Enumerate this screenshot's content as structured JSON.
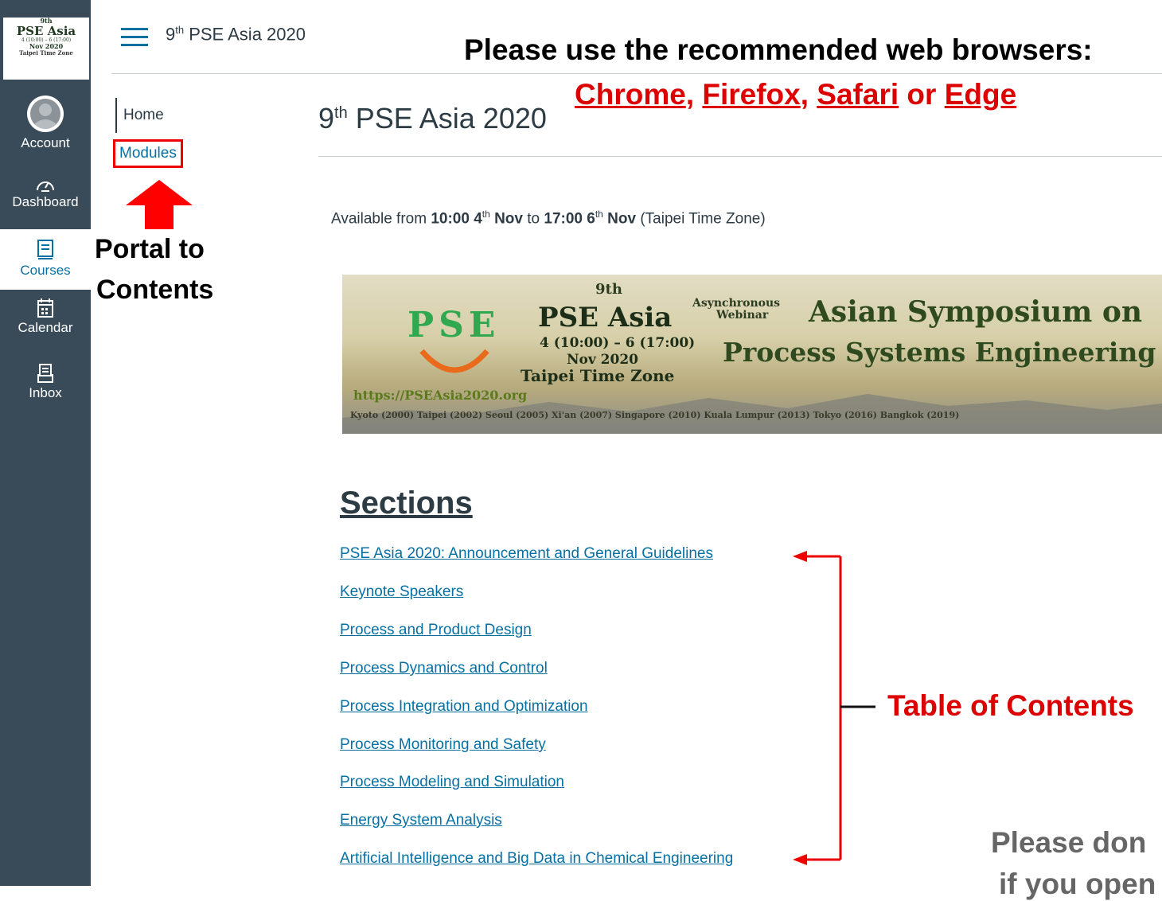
{
  "logo": {
    "sup": "9th",
    "title": "PSE Asia",
    "dates": "4 (10:00) – 6 (17:00)",
    "month": "Nov 2020",
    "tz": "Taipei Time Zone"
  },
  "global_nav": {
    "account": "Account",
    "dashboard": "Dashboard",
    "courses": "Courses",
    "calendar": "Calendar",
    "inbox": "Inbox"
  },
  "breadcrumb": {
    "num": "9",
    "sup": "th",
    "rest": " PSE Asia 2020"
  },
  "course_nav": {
    "home": "Home",
    "modules": "Modules"
  },
  "annotations": {
    "portal_line1": "Portal to",
    "portal_line2": "Contents",
    "browser_warning": "Please use the recommended web browsers:",
    "browsers": [
      "Chrome",
      "Firefox",
      "Safari",
      "Edge"
    ],
    "browsers_sep1": ", ",
    "browsers_sep2": ", ",
    "browsers_sep3": " or ",
    "toc_label": "Table of Contents",
    "note_line1": "Please don",
    "note_line2": "if you open"
  },
  "page": {
    "title_num": "9",
    "title_sup": "th",
    "title_rest": " PSE Asia 2020",
    "avail_pre": "Available from ",
    "avail_t1": "10:00 4",
    "avail_t1sup": "th",
    "avail_t1b": " Nov",
    "avail_mid": " to ",
    "avail_t2": "17:00 6",
    "avail_t2sup": "th",
    "avail_t2b": " Nov",
    "avail_post": " (Taipei Time Zone)",
    "sections_heading": "Sections"
  },
  "banner": {
    "pse": "PSE",
    "sup": "9th",
    "title": "PSE Asia",
    "dates": "4 (10:00) – 6 (17:00)",
    "month": "Nov 2020",
    "tz": "Taipei Time Zone",
    "url": "https://PSEAsia2020.org",
    "async": "Asynchronous",
    "webinar": "Webinar",
    "line1": "Asian Symposium on",
    "line2": "Process Systems Engineering",
    "history": "Kyoto (2000)  Taipei (2002)  Seoul (2005)  Xi'an (2007)  Singapore (2010)  Kuala Lumpur (2013)  Tokyo (2016)  Bangkok (2019)"
  },
  "sections": [
    "PSE Asia 2020: Announcement and General Guidelines",
    "Keynote Speakers",
    "Process and Product Design",
    "Process Dynamics and Control",
    "Process Integration and Optimization ",
    "Process Monitoring and Safety ",
    "Process Modeling and Simulation ",
    "Energy System Analysis",
    "Artificial Intelligence and Big Data in Chemical Engineering"
  ],
  "colors": {
    "nav_bg": "#394b58",
    "link": "#0770a3",
    "annotation_red": "#dd0000"
  }
}
